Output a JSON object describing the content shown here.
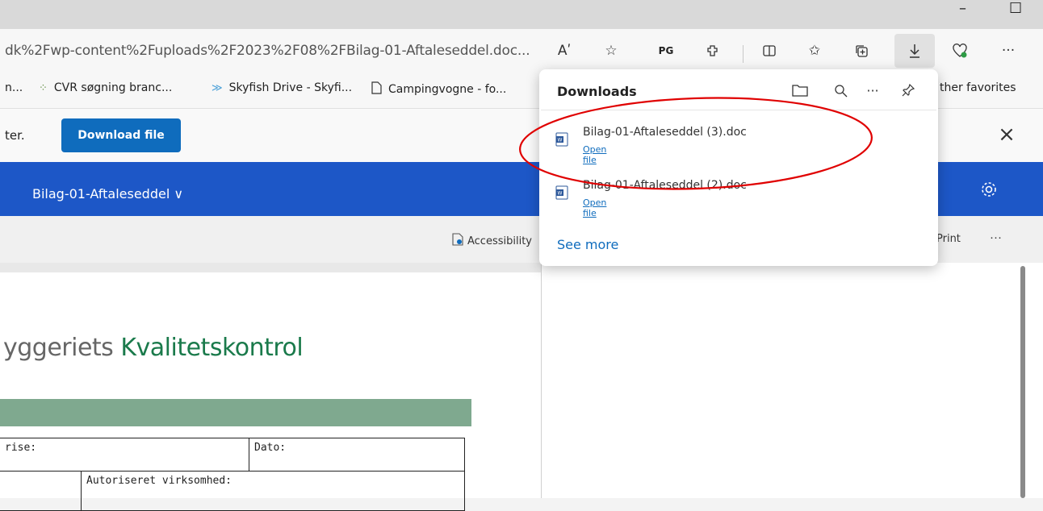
{
  "window": {
    "minimize_glyph": "–",
    "maximize_glyph": "☐"
  },
  "addressbar": {
    "url": "dk%2Fwp-content%2Fuploads%2F2023%2F08%2FBilag-01-Aftaleseddel.doc...",
    "read_aloud_label": "Aʹ",
    "pg_label": "PG"
  },
  "favorites": {
    "items": [
      {
        "label": "n..."
      },
      {
        "label": "CVR søgning branc..."
      },
      {
        "label": "Skyfish Drive - Skyfi..."
      },
      {
        "label": "Campingvogne - fo..."
      }
    ],
    "other": "ther favorites"
  },
  "infobar": {
    "text": "ter.",
    "download_button": "Download file",
    "close_glyph": "×"
  },
  "word": {
    "doc_title": "Bilag-01-Aftaleseddel ∨",
    "accessibility_label": "Accessibility",
    "print_label": "Print",
    "more_glyph": "···"
  },
  "document": {
    "heading_prefix": "yggeriets ",
    "heading_green": "Kvalitetskontrol",
    "table": {
      "row1_col1": "rise:",
      "row1_col2": "Dato:",
      "row2_col2": "Autoriseret virksomhed:"
    }
  },
  "downloads": {
    "title": "Downloads",
    "more_glyph": "···",
    "files": [
      {
        "name": "Bilag-01-Aftaleseddel (3).doc",
        "action": "Open file"
      },
      {
        "name": "Bilag-01-Aftaleseddel (2).doc",
        "action": "Open file"
      }
    ],
    "see_more": "See more"
  },
  "colors": {
    "accent": "#0f6cbd",
    "word_blue": "#1d57c7",
    "heading_green": "#1a7a4b",
    "table_bar": "#7fa98f",
    "annotation_red": "#e00000"
  },
  "icons": [
    "read-aloud-icon",
    "favorite-star-icon",
    "pg-extension-icon",
    "extensions-icon",
    "split-screen-icon",
    "favorites-icon",
    "collections-icon",
    "download-icon",
    "health-icon",
    "more-icon",
    "folder-icon",
    "search-icon",
    "pin-icon",
    "gear-icon",
    "close-icon",
    "word-file-icon"
  ]
}
